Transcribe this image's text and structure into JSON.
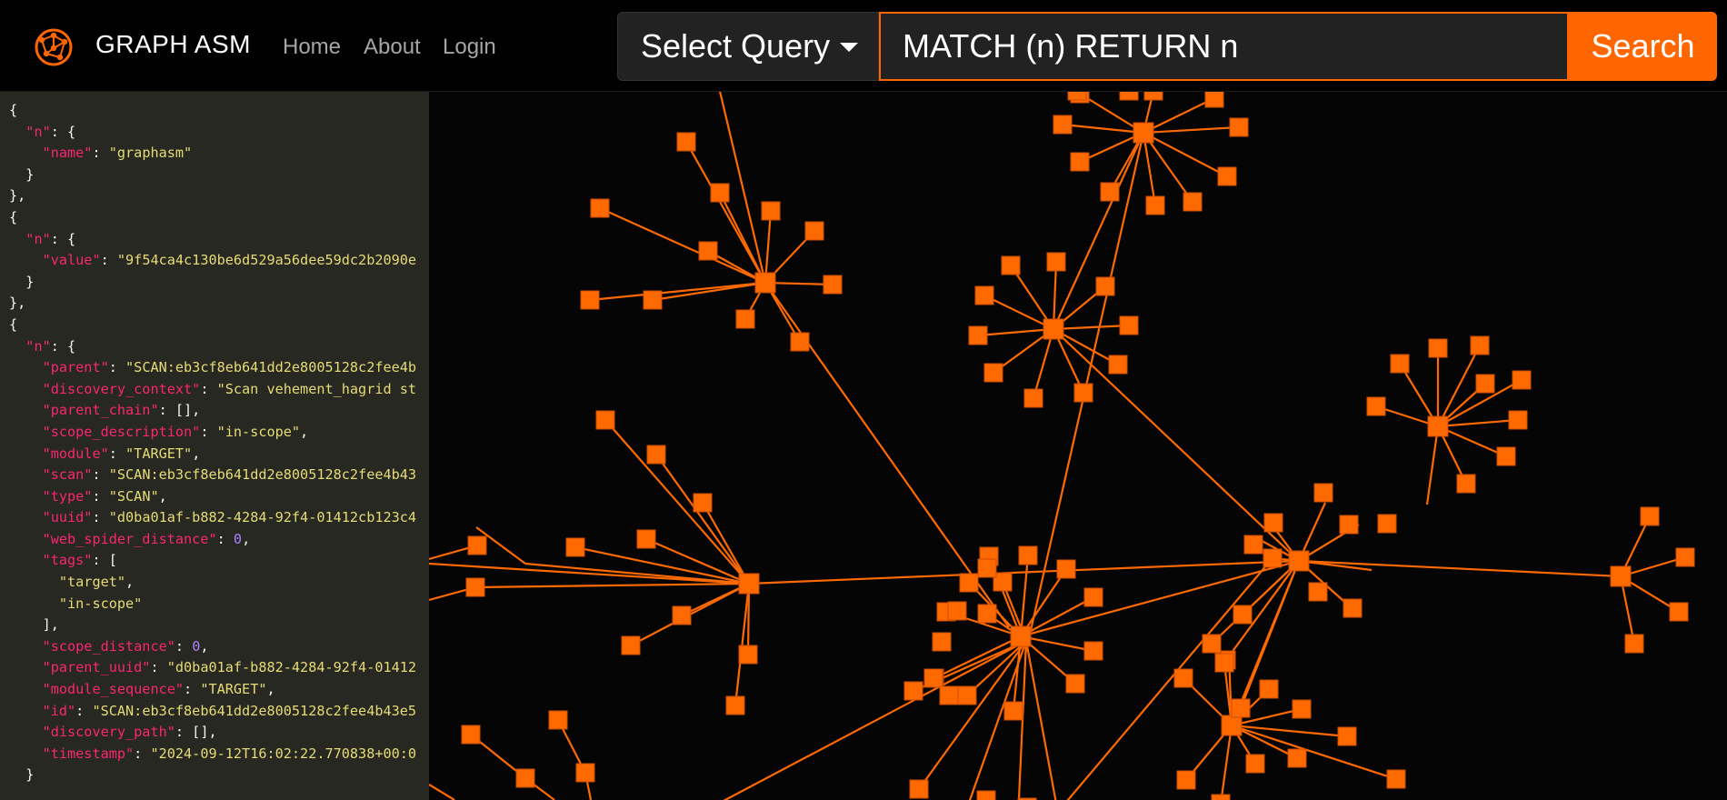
{
  "app": {
    "brand": "GRAPH ASM",
    "brand_icon": "network-globe-icon"
  },
  "nav": {
    "links": [
      "Home",
      "About",
      "Login"
    ]
  },
  "search": {
    "select_label": "Select Query",
    "query_value": "MATCH (n) RETURN n",
    "button_label": "Search"
  },
  "colors": {
    "accent": "#ff6600",
    "panel_bg": "#272822",
    "graph_bg": "#050505",
    "key": "#f92672",
    "string": "#e6db74",
    "number": "#ae81ff"
  },
  "json_lines": [
    [
      {
        "t": "p",
        "v": "{"
      }
    ],
    [
      {
        "t": "p",
        "v": "  "
      },
      {
        "t": "k",
        "v": "\"n\""
      },
      {
        "t": "p",
        "v": ": {"
      }
    ],
    [
      {
        "t": "p",
        "v": "    "
      },
      {
        "t": "k",
        "v": "\"name\""
      },
      {
        "t": "p",
        "v": ": "
      },
      {
        "t": "s",
        "v": "\"graphasm\""
      }
    ],
    [
      {
        "t": "p",
        "v": "  }"
      }
    ],
    [
      {
        "t": "p",
        "v": "},"
      }
    ],
    [
      {
        "t": "p",
        "v": "{"
      }
    ],
    [
      {
        "t": "p",
        "v": "  "
      },
      {
        "t": "k",
        "v": "\"n\""
      },
      {
        "t": "p",
        "v": ": {"
      }
    ],
    [
      {
        "t": "p",
        "v": "    "
      },
      {
        "t": "k",
        "v": "\"value\""
      },
      {
        "t": "p",
        "v": ": "
      },
      {
        "t": "s",
        "v": "\"9f54ca4c130be6d529a56dee59dc2b2090e"
      }
    ],
    [
      {
        "t": "p",
        "v": "  }"
      }
    ],
    [
      {
        "t": "p",
        "v": "},"
      }
    ],
    [
      {
        "t": "p",
        "v": "{"
      }
    ],
    [
      {
        "t": "p",
        "v": "  "
      },
      {
        "t": "k",
        "v": "\"n\""
      },
      {
        "t": "p",
        "v": ": {"
      }
    ],
    [
      {
        "t": "p",
        "v": "    "
      },
      {
        "t": "k",
        "v": "\"parent\""
      },
      {
        "t": "p",
        "v": ": "
      },
      {
        "t": "s",
        "v": "\"SCAN:eb3cf8eb641dd2e8005128c2fee4b"
      }
    ],
    [
      {
        "t": "p",
        "v": "    "
      },
      {
        "t": "k",
        "v": "\"discovery_context\""
      },
      {
        "t": "p",
        "v": ": "
      },
      {
        "t": "s",
        "v": "\"Scan vehement_hagrid st"
      }
    ],
    [
      {
        "t": "p",
        "v": "    "
      },
      {
        "t": "k",
        "v": "\"parent_chain\""
      },
      {
        "t": "p",
        "v": ": [],"
      }
    ],
    [
      {
        "t": "p",
        "v": "    "
      },
      {
        "t": "k",
        "v": "\"scope_description\""
      },
      {
        "t": "p",
        "v": ": "
      },
      {
        "t": "s",
        "v": "\"in-scope\""
      },
      {
        "t": "p",
        "v": ","
      }
    ],
    [
      {
        "t": "p",
        "v": "    "
      },
      {
        "t": "k",
        "v": "\"module\""
      },
      {
        "t": "p",
        "v": ": "
      },
      {
        "t": "s",
        "v": "\"TARGET\""
      },
      {
        "t": "p",
        "v": ","
      }
    ],
    [
      {
        "t": "p",
        "v": "    "
      },
      {
        "t": "k",
        "v": "\"scan\""
      },
      {
        "t": "p",
        "v": ": "
      },
      {
        "t": "s",
        "v": "\"SCAN:eb3cf8eb641dd2e8005128c2fee4b43"
      }
    ],
    [
      {
        "t": "p",
        "v": "    "
      },
      {
        "t": "k",
        "v": "\"type\""
      },
      {
        "t": "p",
        "v": ": "
      },
      {
        "t": "s",
        "v": "\"SCAN\""
      },
      {
        "t": "p",
        "v": ","
      }
    ],
    [
      {
        "t": "p",
        "v": "    "
      },
      {
        "t": "k",
        "v": "\"uuid\""
      },
      {
        "t": "p",
        "v": ": "
      },
      {
        "t": "s",
        "v": "\"d0ba01af-b882-4284-92f4-01412cb123c4"
      }
    ],
    [
      {
        "t": "p",
        "v": "    "
      },
      {
        "t": "k",
        "v": "\"web_spider_distance\""
      },
      {
        "t": "p",
        "v": ": "
      },
      {
        "t": "n",
        "v": "0"
      },
      {
        "t": "p",
        "v": ","
      }
    ],
    [
      {
        "t": "p",
        "v": "    "
      },
      {
        "t": "k",
        "v": "\"tags\""
      },
      {
        "t": "p",
        "v": ": ["
      }
    ],
    [
      {
        "t": "p",
        "v": "      "
      },
      {
        "t": "s",
        "v": "\"target\""
      },
      {
        "t": "p",
        "v": ","
      }
    ],
    [
      {
        "t": "p",
        "v": "      "
      },
      {
        "t": "s",
        "v": "\"in-scope\""
      }
    ],
    [
      {
        "t": "p",
        "v": "    ],"
      }
    ],
    [
      {
        "t": "p",
        "v": "    "
      },
      {
        "t": "k",
        "v": "\"scope_distance\""
      },
      {
        "t": "p",
        "v": ": "
      },
      {
        "t": "n",
        "v": "0"
      },
      {
        "t": "p",
        "v": ","
      }
    ],
    [
      {
        "t": "p",
        "v": "    "
      },
      {
        "t": "k",
        "v": "\"parent_uuid\""
      },
      {
        "t": "p",
        "v": ": "
      },
      {
        "t": "s",
        "v": "\"d0ba01af-b882-4284-92f4-01412"
      }
    ],
    [
      {
        "t": "p",
        "v": "    "
      },
      {
        "t": "k",
        "v": "\"module_sequence\""
      },
      {
        "t": "p",
        "v": ": "
      },
      {
        "t": "s",
        "v": "\"TARGET\""
      },
      {
        "t": "p",
        "v": ","
      }
    ],
    [
      {
        "t": "p",
        "v": "    "
      },
      {
        "t": "k",
        "v": "\"id\""
      },
      {
        "t": "p",
        "v": ": "
      },
      {
        "t": "s",
        "v": "\"SCAN:eb3cf8eb641dd2e8005128c2fee4b43e5"
      }
    ],
    [
      {
        "t": "p",
        "v": "    "
      },
      {
        "t": "k",
        "v": "\"discovery_path\""
      },
      {
        "t": "p",
        "v": ": [],"
      }
    ],
    [
      {
        "t": "p",
        "v": "    "
      },
      {
        "t": "k",
        "v": "\"timestamp\""
      },
      {
        "t": "p",
        "v": ": "
      },
      {
        "t": "s",
        "v": "\"2024-09-12T16:02:22.770838+00:0"
      }
    ],
    [
      {
        "t": "p",
        "v": "  }"
      }
    ]
  ]
}
